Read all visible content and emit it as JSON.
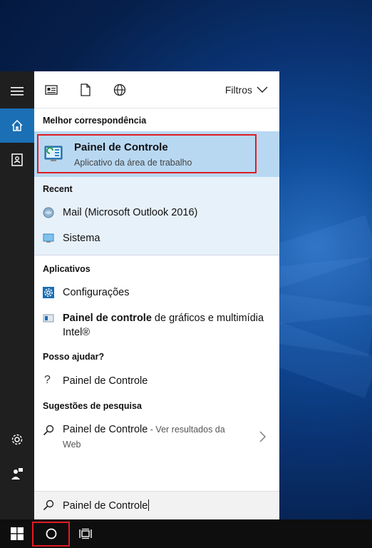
{
  "topbar": {
    "filters_label": "Filtros"
  },
  "sections": {
    "best": "Melhor correspondência",
    "recent": "Recent",
    "apps": "Aplicativos",
    "help": "Posso ajudar?",
    "suggest": "Sugestões de pesquisa"
  },
  "best_match": {
    "title": "Painel de Controle",
    "subtitle": "Aplicativo da área de trabalho"
  },
  "recent_items": [
    {
      "label": "Mail (Microsoft Outlook 2016)"
    },
    {
      "label": "Sistema"
    }
  ],
  "apps_items": [
    {
      "label": "Configurações"
    },
    {
      "bold": "Painel de controle",
      "rest": " de gráficos e multimídia",
      "line2": "Intel®"
    }
  ],
  "help_items": [
    {
      "label": "Painel de Controle"
    }
  ],
  "suggestions": [
    {
      "label": "Painel de Controle",
      "hint": " - Ver resultados da",
      "hint2": "Web"
    }
  ],
  "search": {
    "value": "Painel de Controle"
  },
  "colors": {
    "accent": "#1a6fb5",
    "highlight": "#b8d8f2",
    "annotation": "#e01b24"
  }
}
